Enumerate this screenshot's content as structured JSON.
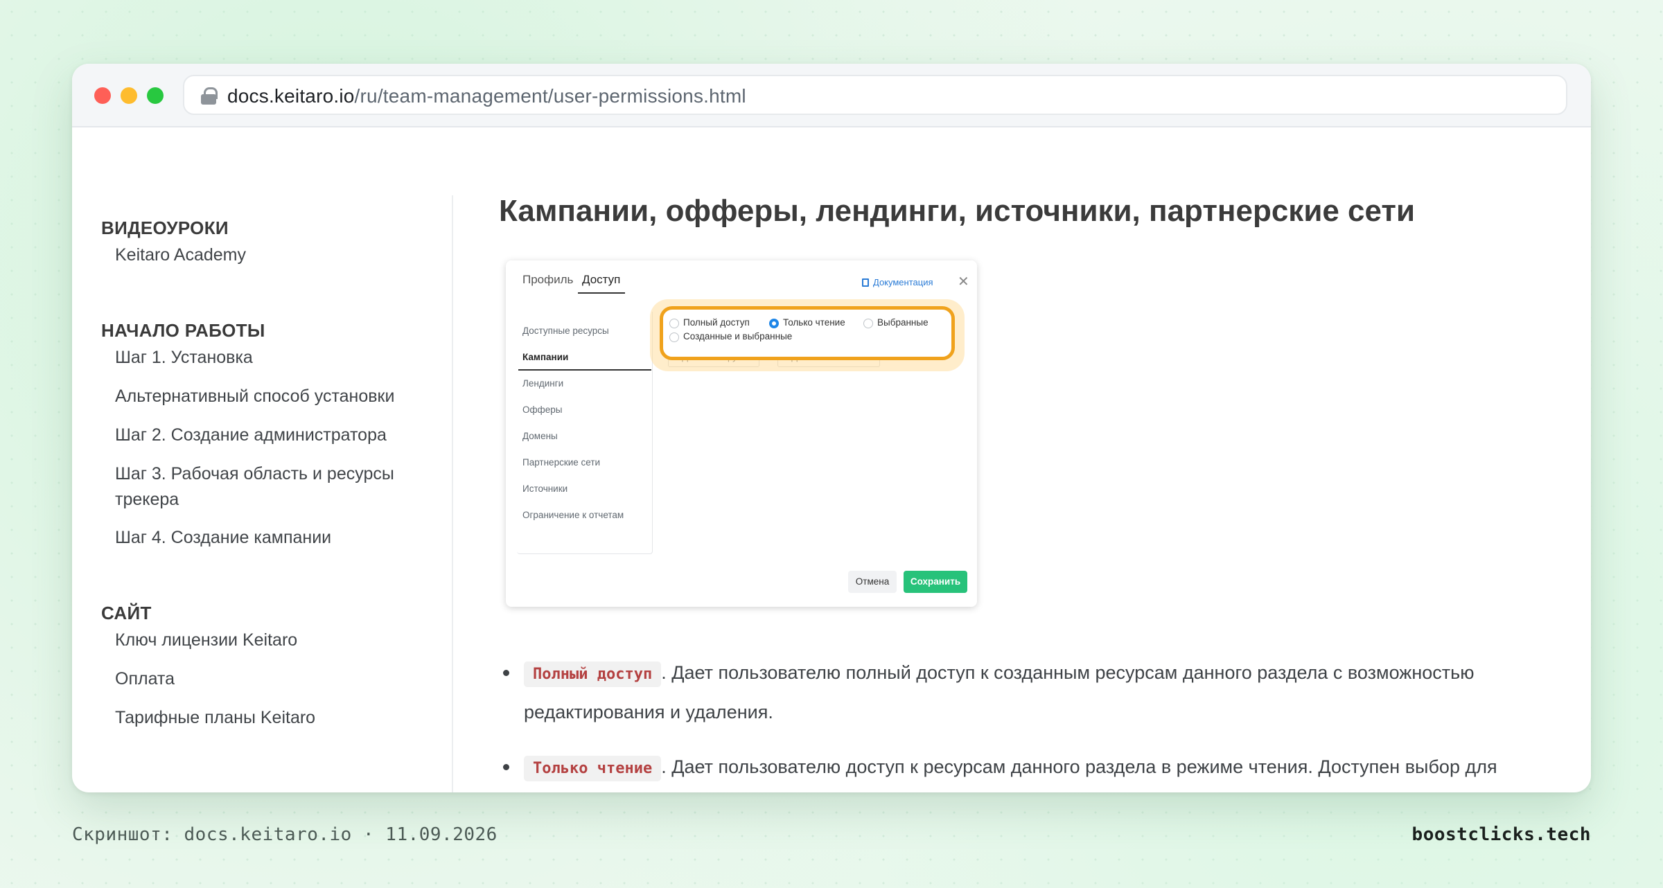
{
  "browser": {
    "url_host": "docs.keitaro.io",
    "url_path": "/ru/team-management/user-permissions.html"
  },
  "sidebar": {
    "sections": [
      {
        "title": "ВИДЕОУРОКИ",
        "items": [
          "Keitaro Academy"
        ]
      },
      {
        "title": "НАЧАЛО РАБОТЫ",
        "items": [
          "Шаг 1. Установка",
          "Альтернативный способ установки",
          "Шаг 2. Создание администратора",
          "Шаг 3. Рабочая область и ресурсы трекера",
          "Шаг 4. Создание кампании"
        ]
      },
      {
        "title": "САЙТ",
        "items": [
          "Ключ лицензии Keitaro",
          "Оплата",
          "Тарифные планы Keitaro"
        ]
      }
    ]
  },
  "main": {
    "heading": "Кампании, офферы, лендинги, источники, партнерские сети",
    "screenshot": {
      "tabs": [
        "Профиль",
        "Доступ"
      ],
      "doc_link": "Документация",
      "close": "✕",
      "resources_header": "Доступные ресурсы",
      "resources": [
        "Кампании",
        "Лендинги",
        "Офферы",
        "Домены",
        "Партнерские сети",
        "Источники",
        "Ограничение к отчетам"
      ],
      "radio_options": [
        "Полный доступ",
        "Только чтение",
        "Выбранные",
        "Созданные и выбранные"
      ],
      "selected_option": "Только чтение",
      "add_buttons": [
        "+ Добавить группы",
        "+ Добавить кампании"
      ],
      "cancel": "Отмена",
      "save": "Сохранить",
      "colors": {
        "highlight": "#f0a21c",
        "save": "#27c27a",
        "radio": "#1e86e8"
      }
    },
    "bullets": [
      {
        "code": "Полный доступ",
        "text": ". Дает пользователю полный доступ к созданным ресурсам данного раздела с возможностью редактирования и удаления."
      },
      {
        "code": "Только чтение",
        "text": ". Дает пользователю доступ к ресурсам данного раздела в режиме чтения. Доступен выбор для"
      }
    ]
  },
  "footer": {
    "caption": "Скриншот: docs.keitaro.io · 11.09.2026",
    "brand": "boostclicks.tech"
  }
}
